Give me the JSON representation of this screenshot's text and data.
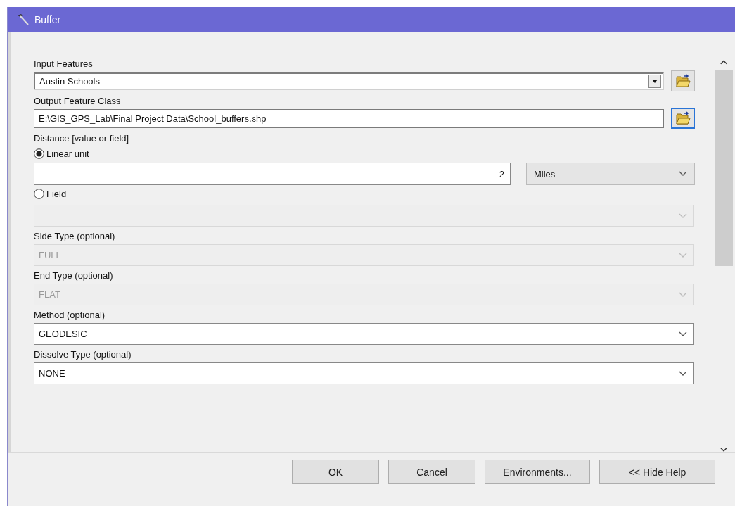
{
  "window": {
    "title": "Buffer"
  },
  "params": [
    {
      "kind": "combo_browse",
      "label": "Input Features",
      "value": "Austin Schools",
      "browse_focused": false
    },
    {
      "kind": "text_browse",
      "label": "Output Feature Class",
      "value": "E:\\GIS_GPS_Lab\\Final Project Data\\School_buffers.shp",
      "browse_focused": true
    },
    {
      "kind": "heading",
      "label": "Distance [value or field]"
    },
    {
      "kind": "radio",
      "label": "Linear unit",
      "selected": true
    },
    {
      "kind": "linear",
      "value": "2",
      "unit": "Miles"
    },
    {
      "kind": "radio",
      "label": "Field",
      "selected": false
    },
    {
      "kind": "dropdown",
      "disabled": true
    },
    {
      "kind": "dropdown",
      "label": "Side Type (optional)",
      "value": "FULL",
      "disabled": true
    },
    {
      "kind": "dropdown",
      "label": "End Type (optional)",
      "value": "FLAT",
      "disabled": true
    },
    {
      "kind": "dropdown",
      "label": "Method (optional)",
      "value": "GEODESIC",
      "disabled": false
    },
    {
      "kind": "dropdown",
      "label": "Dissolve Type (optional)",
      "value": "NONE",
      "disabled": false
    }
  ],
  "buttons": [
    "OK",
    "Cancel",
    "Environments...",
    "<< Hide Help"
  ]
}
